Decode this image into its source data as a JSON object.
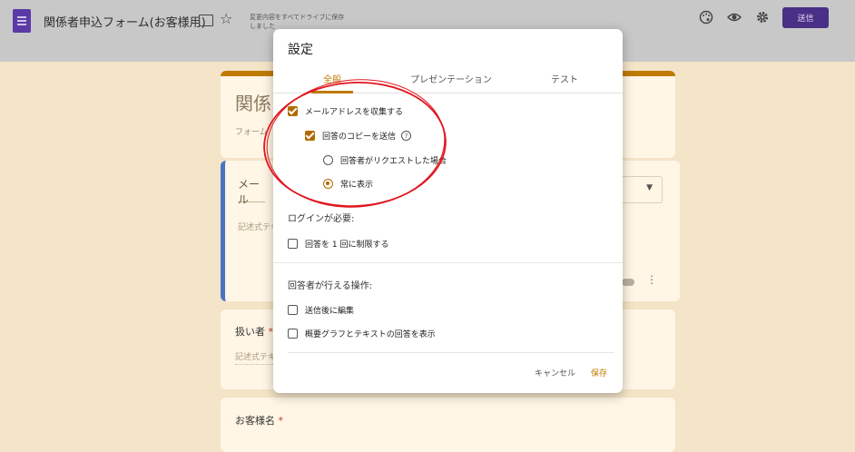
{
  "app": {
    "title": "関係者申込フォーム(お客様用)",
    "save_status": "変更内容をすべてドライブに保存しました",
    "send_label": "送信"
  },
  "background_form": {
    "title_partial": "関係",
    "description_partial": "フォーム",
    "question1_partial": "メール",
    "question1_hint_partial": "記述式テキ",
    "question2_label": "扱い者",
    "question2_hint_partial": "記述式テキ",
    "question3_label": "お客様名",
    "required_mark": "*"
  },
  "dialog": {
    "title": "設定",
    "tabs": [
      {
        "label": "全般",
        "active": true
      },
      {
        "label": "プレゼンテーション",
        "active": false
      },
      {
        "label": "テスト",
        "active": false
      }
    ],
    "collect_email": {
      "label": "メールアドレスを収集する",
      "checked": true
    },
    "send_copy": {
      "label": "回答のコピーを送信",
      "checked": true
    },
    "copy_options": [
      {
        "label": "回答者がリクエストした場合",
        "selected": false
      },
      {
        "label": "常に表示",
        "selected": true
      }
    ],
    "login_section": "ログインが必要:",
    "limit_one": {
      "label": "回答を 1 回に制限する",
      "checked": false
    },
    "respondent_section": "回答者が行える操作:",
    "edit_after": {
      "label": "送信後に編集",
      "checked": false
    },
    "view_summary": {
      "label": "概要グラフとテキストの回答を表示",
      "checked": false
    },
    "cancel_label": "キャンセル",
    "save_label": "保存"
  },
  "colors": {
    "accent": "#c07a00",
    "send_button": "#4a2f87",
    "annotation": "#e0161e"
  }
}
